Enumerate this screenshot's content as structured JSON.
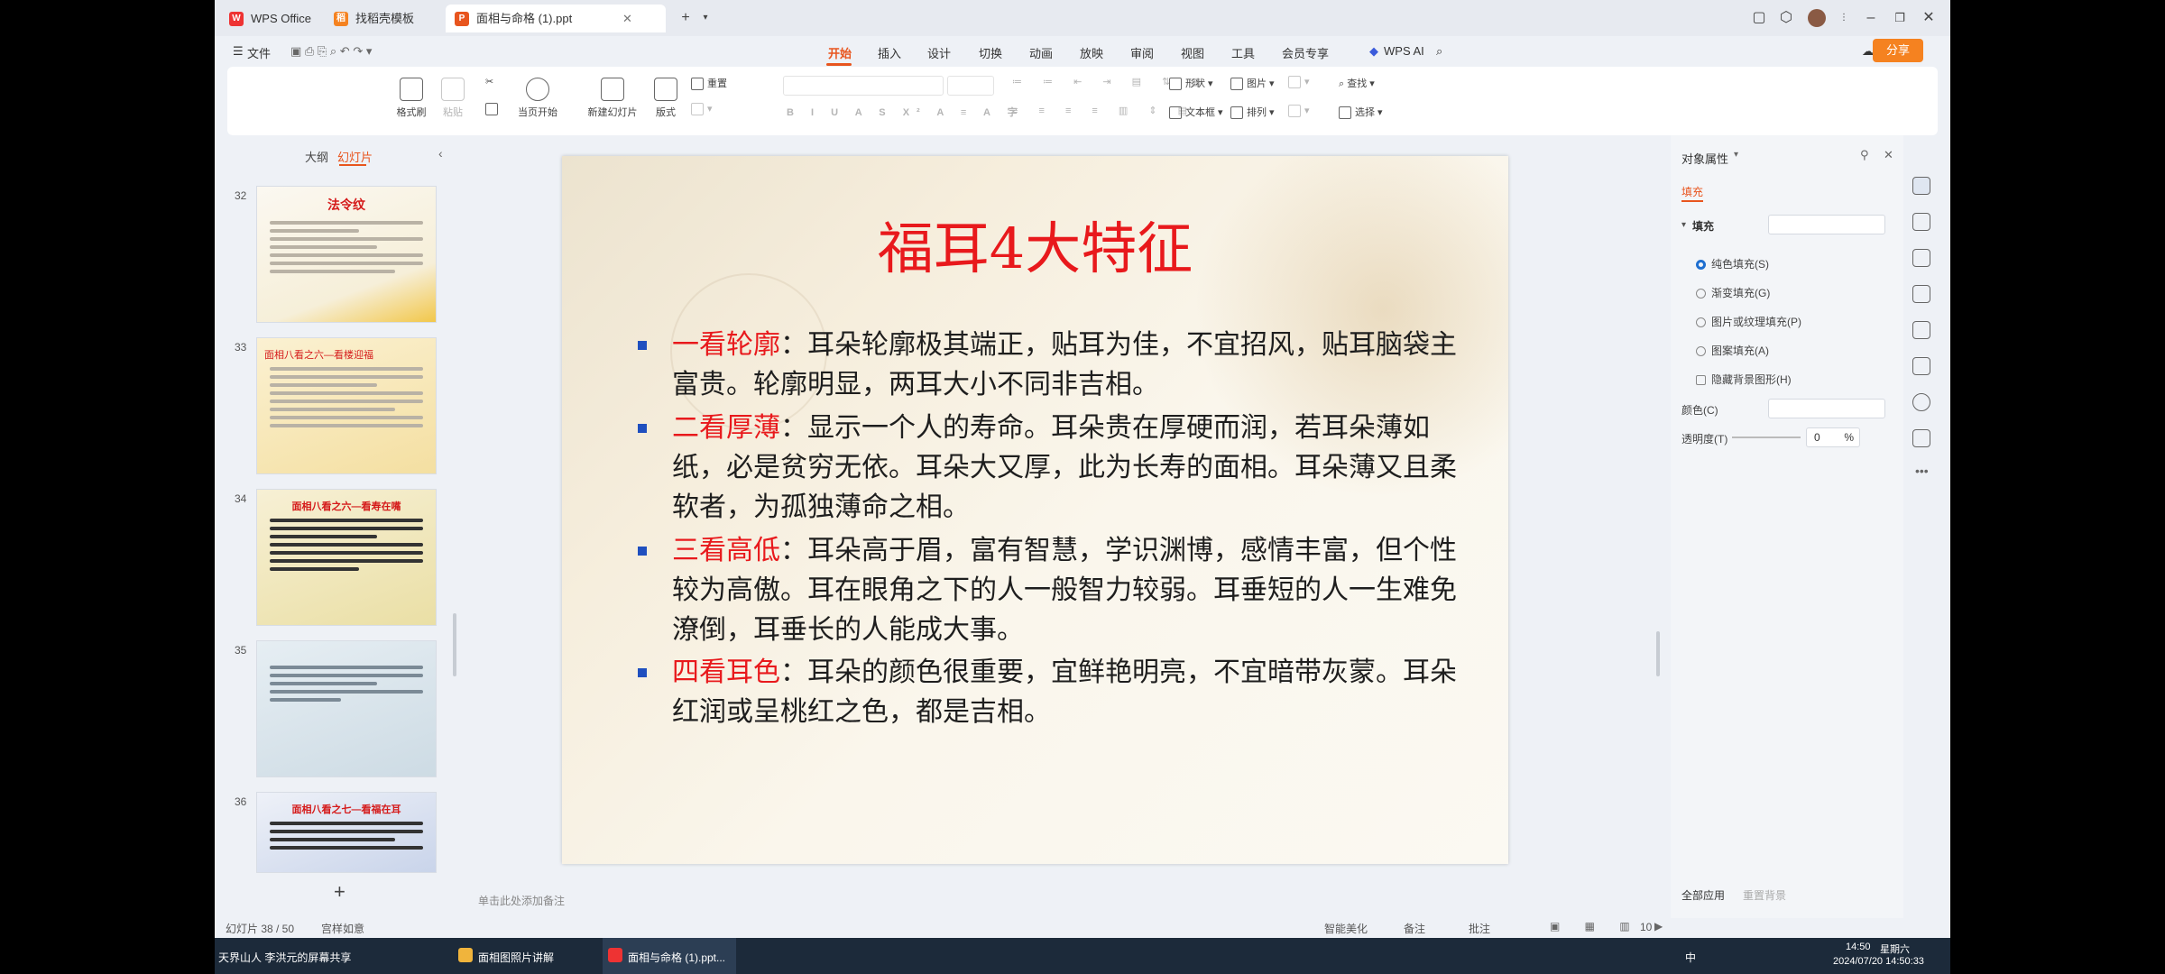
{
  "window": {
    "tabs": [
      {
        "label": "WPS Office"
      },
      {
        "label": "找稻壳模板"
      },
      {
        "label": "面相与命格 (1).ppt"
      }
    ]
  },
  "menu": {
    "file_label": "文件",
    "tabs": [
      "开始",
      "插入",
      "设计",
      "切换",
      "动画",
      "放映",
      "审阅",
      "视图",
      "工具",
      "会员专享"
    ],
    "active_tab": "开始",
    "wps_ai_label": "WPS AI",
    "share_label": "分享"
  },
  "ribbon": {
    "format_painter": "格式刷",
    "paste": "粘贴",
    "play_from_current": "当页开始",
    "new_slide": "新建幻灯片",
    "layout": "版式",
    "reset": "重置",
    "shape": "形状",
    "picture": "图片",
    "textbox": "文本框",
    "arrange": "排列",
    "find": "查找",
    "select": "选择"
  },
  "left_panel": {
    "tab_outline": "大纲",
    "tab_slides": "幻灯片",
    "thumbnails": [
      {
        "number": "32",
        "title": "法令纹"
      },
      {
        "number": "33",
        "title": "面相八看之六—看楼迎福"
      },
      {
        "number": "34",
        "title": "面相八看之六—看寿在嘴"
      },
      {
        "number": "35",
        "title": ""
      },
      {
        "number": "36",
        "title": "面相八看之七—看福在耳"
      }
    ],
    "add_button": "+"
  },
  "slide": {
    "title": "福耳4大特征",
    "points": [
      {
        "heading": "一看轮廓",
        "body": "：耳朵轮廓极其端正，贴耳为佳，不宜招风，贴耳脑袋主富贵。轮廓明显，两耳大小不同非吉相。"
      },
      {
        "heading": "二看厚薄",
        "body": "：显示一个人的寿命。耳朵贵在厚硬而润，若耳朵薄如纸，必是贫穷无依。耳朵大又厚，此为长寿的面相。耳朵薄又且柔软者，为孤独薄命之相。"
      },
      {
        "heading": "三看高低",
        "body": "：耳朵高于眉，富有智慧，学识渊博，感情丰富，但个性较为高傲。耳在眼角之下的人一般智力较弱。耳垂短的人一生难免潦倒，耳垂长的人能成大事。"
      },
      {
        "heading": "四看耳色",
        "body": "：耳朵的颜色很重要，宜鲜艳明亮，不宜暗带灰蒙。耳朵红润或呈桃红之色，都是吉相。"
      }
    ],
    "notes_placeholder": "单击此处添加备注"
  },
  "right_panel": {
    "title": "对象属性",
    "tab_fill": "填充",
    "section_fill": "填充",
    "options": [
      "纯色填充(S)",
      "渐变填充(G)",
      "图片或纹理填充(P)",
      "图案填充(A)"
    ],
    "hide_bg_label": "隐藏背景图形(H)",
    "color_label": "颜色(C)",
    "transparency_label": "透明度(T)",
    "transparency_value": "0",
    "transparency_unit": "%",
    "apply_all": "全部应用",
    "reset_bg": "重置背景"
  },
  "status": {
    "slide_counter": "幻灯片 38 / 50",
    "theme": "宫样如意",
    "smart_beautify": "智能美化",
    "notes": "备注",
    "comments": "批注",
    "zoom": "10"
  },
  "taskbar": {
    "presenter_text": "天界山人 李洪元的屏幕共享",
    "apps": [
      "面相图照片讲解",
      "面相与命格 (1).ppt..."
    ],
    "ime": "中",
    "time": "14:50",
    "weekday": "星期六",
    "datetime": "2024/07/20 14:50:33"
  },
  "colors": {
    "accent_orange": "#f58220",
    "slide_title_red": "#e8191c",
    "bullet_blue": "#1f4fbf",
    "active_tab_color": "#f58220"
  }
}
